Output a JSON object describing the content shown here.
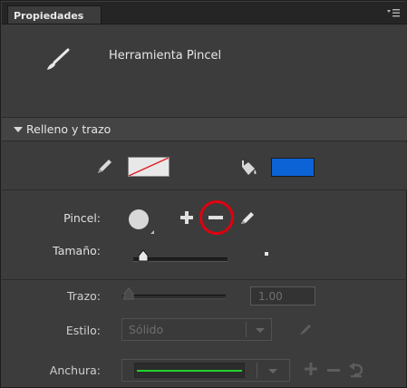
{
  "panel": {
    "tab_label": "Propiedades",
    "menu_icon": "panel-menu-icon"
  },
  "tool": {
    "name": "Herramienta Pincel",
    "icon": "brush-icon"
  },
  "section": {
    "label": "Relleno y trazo",
    "expanded": true
  },
  "fill_stroke": {
    "stroke_color": "none",
    "fill_color": "#0b63d6",
    "stroke_icon": "pencil-icon",
    "fill_icon": "paint-bucket-icon"
  },
  "brush": {
    "label": "Pincel:",
    "shape": "circle"
  },
  "size": {
    "label": "Tamaño:",
    "value_fraction": 0.15
  },
  "stroke": {
    "label": "Trazo:",
    "value": "1.00",
    "value_fraction": 0.0
  },
  "style": {
    "label": "Estilo:",
    "selected": "Sólido"
  },
  "width": {
    "label": "Anchura:",
    "preview_color": "#22d22c"
  },
  "highlight": {
    "color": "#e1000f",
    "target": "remove-brush-button"
  }
}
